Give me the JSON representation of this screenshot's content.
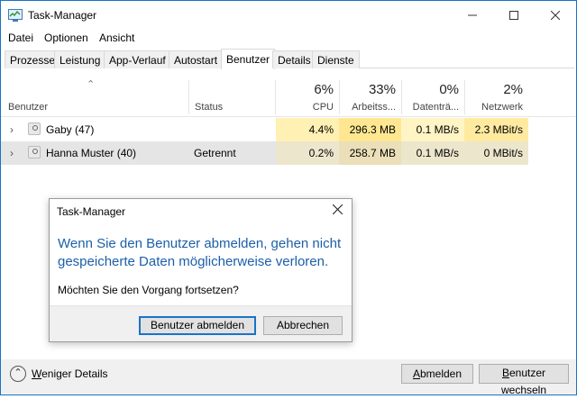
{
  "window": {
    "title": "Task-Manager"
  },
  "menu": [
    "Datei",
    "Optionen",
    "Ansicht"
  ],
  "tabs": [
    "Prozesse",
    "Leistung",
    "App-Verlauf",
    "Autostart",
    "Benutzer",
    "Details",
    "Dienste"
  ],
  "active_tab": "Benutzer",
  "columns": {
    "user": "Benutzer",
    "status": "Status",
    "cpu": {
      "pct": "6%",
      "label": "CPU"
    },
    "memory": {
      "pct": "33%",
      "label": "Arbeitss..."
    },
    "disk": {
      "pct": "0%",
      "label": "Datenträ..."
    },
    "network": {
      "pct": "2%",
      "label": "Netzwerk"
    }
  },
  "rows": [
    {
      "name": "Gaby (47)",
      "status": "",
      "cpu": "4.4%",
      "memory": "296.3 MB",
      "disk": "0.1 MB/s",
      "network": "2.3 MBit/s"
    },
    {
      "name": "Hanna Muster (40)",
      "status": "Getrennt",
      "cpu": "0.2%",
      "memory": "258.7 MB",
      "disk": "0.1 MB/s",
      "network": "0 MBit/s"
    }
  ],
  "dialog": {
    "title": "Task-Manager",
    "main_line1": "Wenn Sie den Benutzer abmelden, gehen nicht",
    "main_line2": "gespeicherte Daten möglicherweise verloren.",
    "sub": "Möchten Sie den Vorgang fortsetzen?",
    "confirm": "Benutzer abmelden",
    "cancel": "Abbrechen"
  },
  "bottom": {
    "fewer_details_first": "W",
    "fewer_details_rest": "eniger Details",
    "logout_first": "A",
    "logout_rest": "bmelden",
    "switch_first": "B",
    "switch_rest": "enutzer wechseln"
  },
  "colors": {
    "heat_light": "#fff4c4",
    "heat_strong": "#ffe792",
    "accent": "#1a73c8",
    "dialog_text": "#1c5fa8"
  }
}
